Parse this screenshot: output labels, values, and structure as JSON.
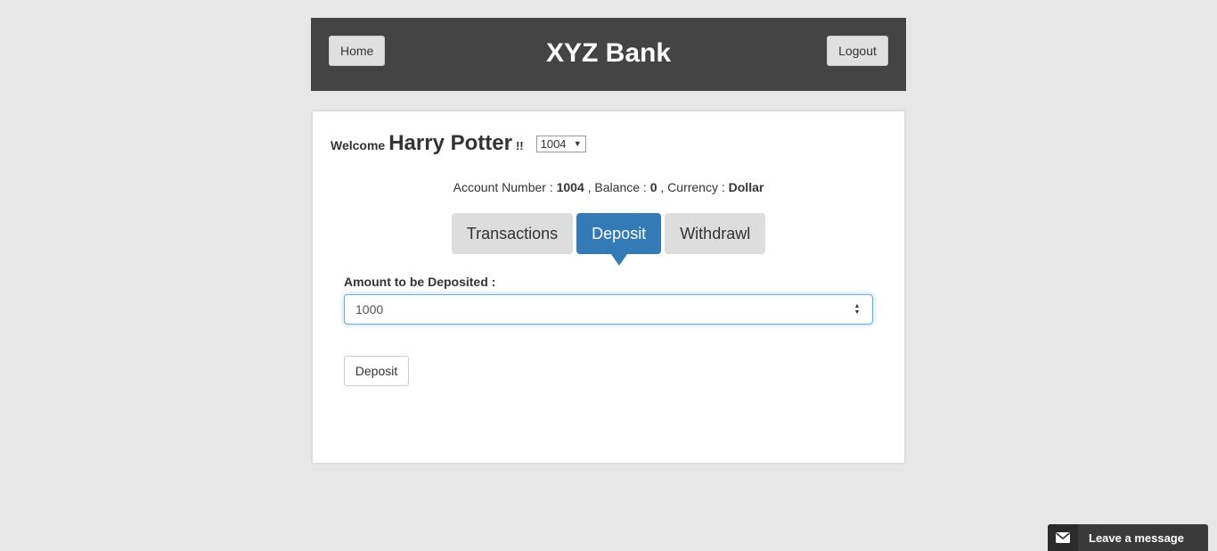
{
  "header": {
    "home_label": "Home",
    "title": "XYZ Bank",
    "logout_label": "Logout"
  },
  "customer": {
    "welcome_label": "Welcome",
    "name": "Harry Potter",
    "exclaim": "!!",
    "account_select": {
      "selected": "1004"
    }
  },
  "account_info": {
    "number_label": "Account Number :",
    "number": "1004",
    "balance_label": ", Balance :",
    "balance": "0",
    "currency_label": ", Currency :",
    "currency": "Dollar"
  },
  "tabs": [
    {
      "label": "Transactions",
      "active": false
    },
    {
      "label": "Deposit",
      "active": true
    },
    {
      "label": "Withdrawl",
      "active": false
    }
  ],
  "deposit_form": {
    "amount_label": "Amount to be Deposited :",
    "amount_value": "1000",
    "submit_label": "Deposit"
  },
  "chat": {
    "label": "Leave a message"
  },
  "colors": {
    "header_bg": "#444444",
    "active_tab": "#337ab7",
    "page_bg": "#e7e7e7"
  }
}
